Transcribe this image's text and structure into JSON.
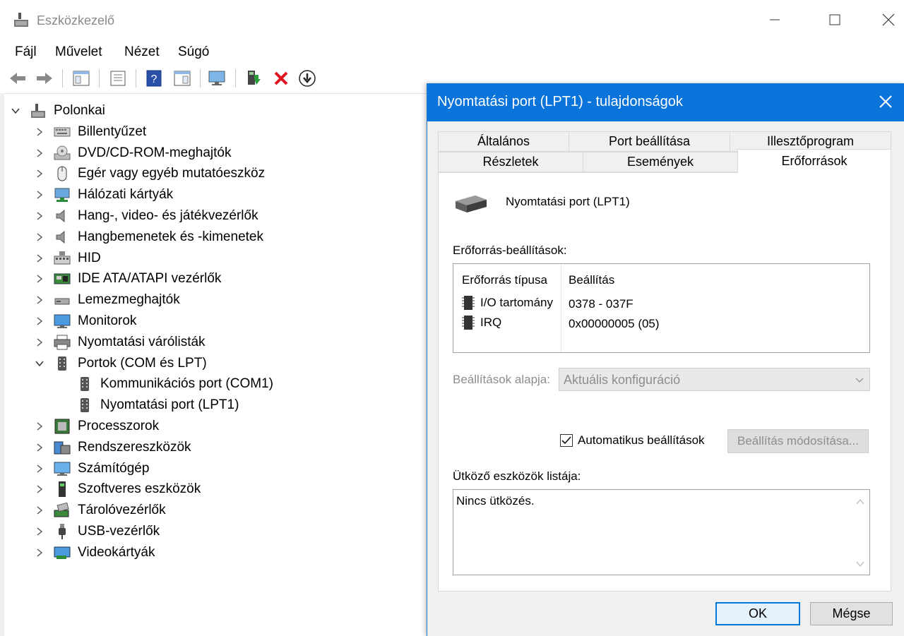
{
  "window": {
    "title": "Eszközkezelő"
  },
  "menu": [
    "Fájl",
    "Művelet",
    "Nézet",
    "Súgó"
  ],
  "tree": {
    "root": "Polonkai",
    "items": [
      {
        "label": "Billentyűzet",
        "icon": "keyboard-icon",
        "expanded": false
      },
      {
        "label": "DVD/CD-ROM-meghajtók",
        "icon": "disc-drive-icon",
        "expanded": false
      },
      {
        "label": "Egér vagy egyéb mutatóeszköz",
        "icon": "mouse-icon",
        "expanded": false
      },
      {
        "label": "Hálózati kártyák",
        "icon": "network-adapter-icon",
        "expanded": false
      },
      {
        "label": "Hang-, video- és játékvezérlők",
        "icon": "speaker-icon",
        "expanded": false
      },
      {
        "label": "Hangbemenetek és -kimenetek",
        "icon": "speaker-icon",
        "expanded": false
      },
      {
        "label": "HID",
        "icon": "hid-icon",
        "expanded": false
      },
      {
        "label": "IDE ATA/ATAPI vezérlők",
        "icon": "ide-controller-icon",
        "expanded": false
      },
      {
        "label": "Lemezmeghajtók",
        "icon": "disk-drive-icon",
        "expanded": false
      },
      {
        "label": "Monitorok",
        "icon": "monitor-icon",
        "expanded": false
      },
      {
        "label": "Nyomtatási várólisták",
        "icon": "printer-icon",
        "expanded": false
      },
      {
        "label": "Portok (COM és LPT)",
        "icon": "port-icon",
        "expanded": true,
        "children": [
          "Kommunikációs port (COM1)",
          "Nyomtatási port (LPT1)"
        ]
      },
      {
        "label": "Processzorok",
        "icon": "processor-icon",
        "expanded": false
      },
      {
        "label": "Rendszereszközök",
        "icon": "system-devices-icon",
        "expanded": false
      },
      {
        "label": "Számítógép",
        "icon": "computer-icon",
        "expanded": false
      },
      {
        "label": "Szoftveres eszközök",
        "icon": "software-device-icon",
        "expanded": false
      },
      {
        "label": "Tárolóvezérlők",
        "icon": "storage-controller-icon",
        "expanded": false
      },
      {
        "label": "USB-vezérlők",
        "icon": "usb-icon",
        "expanded": false
      },
      {
        "label": "Videokártyák",
        "icon": "display-adapter-icon",
        "expanded": false
      }
    ]
  },
  "dialog": {
    "title": "Nyomtatási port (LPT1) - tulajdonságok",
    "tabs_row1": [
      "Általános",
      "Port beállítása",
      "Illesztőprogram"
    ],
    "tabs_row2": [
      "Részletek",
      "Események",
      "Erőforrások"
    ],
    "active_tab": "Erőforrások",
    "device_name": "Nyomtatási port (LPT1)",
    "resource_settings_label": "Erőforrás-beállítások:",
    "columns": {
      "type": "Erőforrás típusa",
      "setting": "Beállítás"
    },
    "resources": [
      {
        "type": "I/O tartomány",
        "setting": "0378 - 037F"
      },
      {
        "type": "IRQ",
        "setting": "0x00000005 (05)"
      }
    ],
    "settings_based_on_label": "Beállítások alapja:",
    "settings_based_on_value": "Aktuális konfiguráció",
    "auto_settings_label": "Automatikus beállítások",
    "auto_settings_checked": true,
    "change_setting_button": "Beállítás módosítása...",
    "conflict_label": "Ütköző eszközök listája:",
    "conflict_text": "Nincs ütközés.",
    "ok": "OK",
    "cancel": "Mégse"
  }
}
